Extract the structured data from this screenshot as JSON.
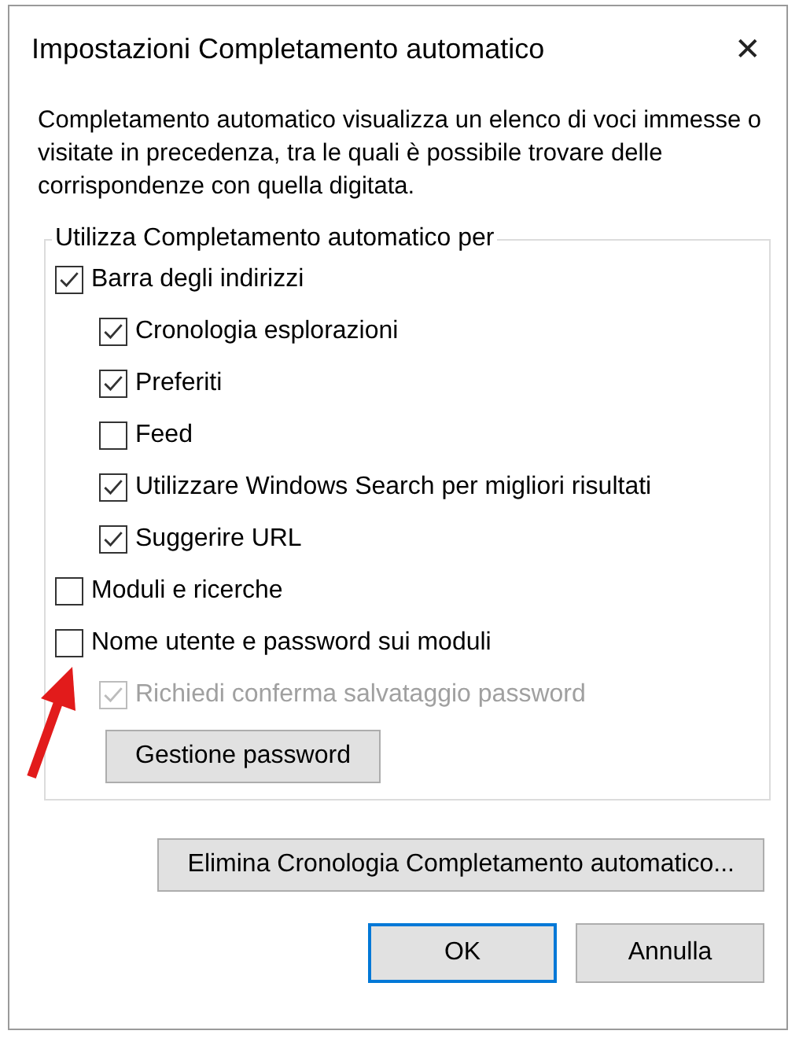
{
  "window": {
    "title": "Impostazioni Completamento automatico",
    "close": "✕"
  },
  "description": "Completamento automatico visualizza un elenco di voci immesse o visitate in precedenza, tra le quali è possibile trovare delle corrispondenze con quella digitata.",
  "group": {
    "label": "Utilizza Completamento automatico per",
    "items": [
      {
        "label": "Barra degli indirizzi",
        "checked": true,
        "disabled": false,
        "children": [
          {
            "label": "Cronologia esplorazioni",
            "checked": true,
            "disabled": false
          },
          {
            "label": "Preferiti",
            "checked": true,
            "disabled": false
          },
          {
            "label": "Feed",
            "checked": false,
            "disabled": false
          },
          {
            "label": "Utilizzare Windows Search per migliori risultati",
            "checked": true,
            "disabled": false
          },
          {
            "label": "Suggerire URL",
            "checked": true,
            "disabled": false
          }
        ]
      },
      {
        "label": "Moduli e ricerche",
        "checked": false,
        "disabled": false
      },
      {
        "label": "Nome utente e password sui moduli",
        "checked": false,
        "disabled": false,
        "children": [
          {
            "label": "Richiedi conferma salvataggio password",
            "checked": true,
            "disabled": true
          }
        ]
      }
    ],
    "button": "Gestione password"
  },
  "delete_button": "Elimina Cronologia Completamento automatico...",
  "buttons": [
    {
      "label": "OK",
      "focused": true
    },
    {
      "label": "Annulla",
      "focused": false
    }
  ]
}
